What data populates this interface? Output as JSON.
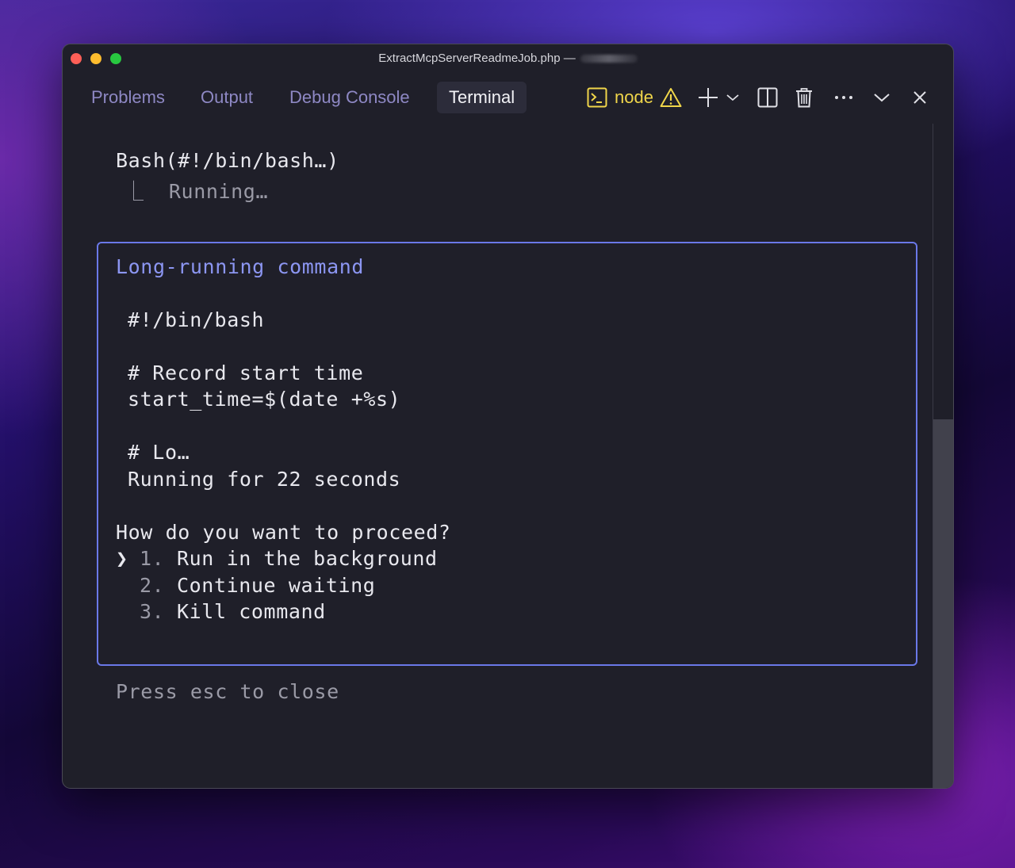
{
  "window": {
    "title": "ExtractMcpServerReadmeJob.php —"
  },
  "tabs": [
    {
      "label": "Problems"
    },
    {
      "label": "Output"
    },
    {
      "label": "Debug Console"
    },
    {
      "label": "Terminal",
      "active": true
    }
  ],
  "toolbar": {
    "terminal_name": "node",
    "icons": [
      "terminal-icon",
      "warning-icon",
      "plus-icon",
      "chevron-down-icon",
      "split-icon",
      "trash-icon",
      "more-icon",
      "collapse-icon",
      "close-icon"
    ],
    "accent_color": "#f0d64a"
  },
  "terminal": {
    "command": "Bash(#!/bin/bash…)",
    "status_line": "⎿  Running…",
    "dialog": {
      "title": "Long-running command",
      "code_lines": [
        "#!/bin/bash",
        "",
        "# Record start time",
        "start_time=$(date +%s)",
        "",
        "# Lo…",
        "Running for 22 seconds"
      ],
      "question": "How do you want to proceed?",
      "cursor": "❯",
      "options": [
        {
          "num": "1.",
          "label": "Run in the background",
          "selected": true
        },
        {
          "num": "2.",
          "label": "Continue waiting"
        },
        {
          "num": "3.",
          "label": "Kill command"
        }
      ],
      "border_color": "#6a78e8"
    },
    "hint": "Press esc to close"
  }
}
